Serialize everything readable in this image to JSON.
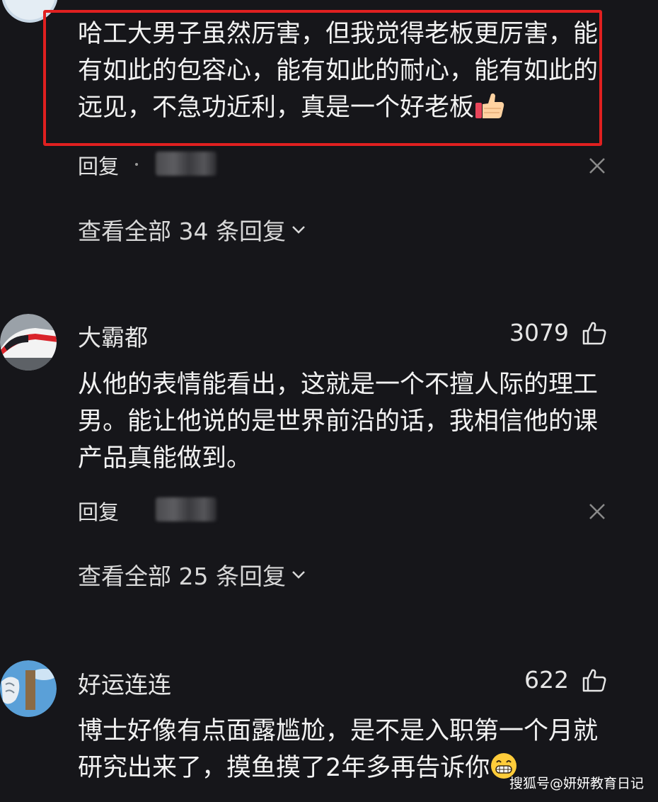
{
  "comments": [
    {
      "text": "哈工大男子虽然厉害，但我觉得老板更厉害，能有如此的包容心，能有如此的耐心，能有如此的远见，不急功近利，真是一个好老板",
      "emoji": "thumbs-up-emoji",
      "reply_label": "回复",
      "view_all": "查看全部 34 条回复"
    },
    {
      "username": "大霸都",
      "likes": "3079",
      "text": "从他的表情能看出，这就是一个不擅人际的理工男。能让他说的是世界前沿的话，我相信他的课产品真能做到。",
      "reply_label": "回复",
      "view_all": "查看全部 25 条回复"
    },
    {
      "username": "好运连连",
      "likes": "622",
      "text": "博士好像有点面露尴尬，是不是入职第一个月就研究出来了，摸鱼摸了2年多再告诉你",
      "emoji": "grinning-emoji"
    }
  ],
  "watermark": "搜狐号@妍妍教育日记",
  "colors": {
    "background": "#16161a",
    "highlight_border": "#e02020",
    "text": "#f2f2f2"
  }
}
